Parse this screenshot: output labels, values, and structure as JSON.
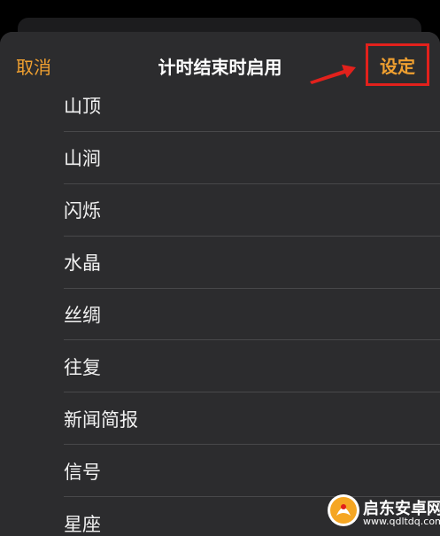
{
  "nav": {
    "cancel_label": "取消",
    "title": "计时结束时启用",
    "set_label": "设定"
  },
  "list": {
    "items": [
      "山顶",
      "山涧",
      "闪烁",
      "水晶",
      "丝绸",
      "往复",
      "新闻简报",
      "信号",
      "星座"
    ]
  },
  "watermark": {
    "name": "启东安卓网",
    "url": "www.qdltdq.com"
  },
  "colors": {
    "accent": "#f0a030",
    "highlight_box": "#e2211c",
    "sheet_bg": "#2c2c2e",
    "separator": "#48484a"
  },
  "icons": {
    "pointer": "red-arrow-icon",
    "watermark_logo": "watermark-logo-icon"
  }
}
